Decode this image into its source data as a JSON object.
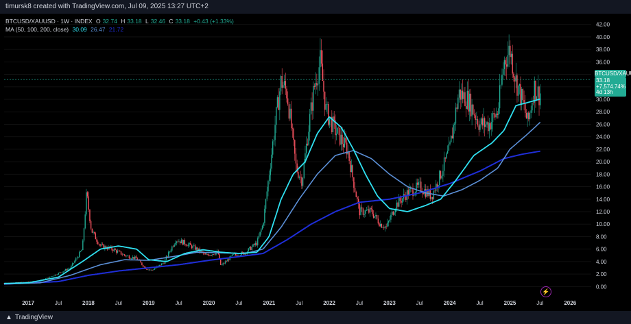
{
  "caption": "timursk8 created with TradingView.com, Jul 09, 2025 13:27 UTC+2",
  "symbol": {
    "name": "BTCUSD/XAUUSD · 1W · INDEX",
    "open_label": "O",
    "open": "32.74",
    "high_label": "H",
    "high": "33.18",
    "low_label": "L",
    "low": "32.46",
    "close_label": "C",
    "close": "33.18",
    "change": "+0.43 (+1.33%)"
  },
  "ma": {
    "label": "MA (50, 100, 200, close)",
    "v50": "30.09",
    "v100": "26.47",
    "v200": "21.72"
  },
  "price_tag": {
    "name": "BTCUSD/XAUUSD",
    "value": "33.18",
    "pct": "+7,574.74%",
    "time": "4d 13h"
  },
  "footer": {
    "brand": "TradingView"
  },
  "colors": {
    "up": "#22ab94",
    "down": "#f7525f",
    "ma50": "#2fe0f0",
    "ma100": "#5b8fd6",
    "ma200": "#1f2ed8",
    "price_line": "#22ab94",
    "grid": "#1a1a1a",
    "axis_text": "#d1d4dc"
  },
  "chart_data": {
    "type": "candlestick",
    "yticks": [
      0,
      2,
      4,
      6,
      8,
      10,
      12,
      14,
      16,
      18,
      20,
      22,
      24,
      26,
      28,
      30,
      32,
      34,
      36,
      38,
      40,
      42
    ],
    "ytick_labels": [
      "0.00",
      "2.00",
      "4.00",
      "6.00",
      "8.00",
      "10.00",
      "12.00",
      "14.00",
      "16.00",
      "18.00",
      "20.00",
      "22.00",
      "24.00",
      "26.00",
      "28.00",
      "30.00",
      "32.00",
      "34.00",
      "36.00",
      "38.00",
      "40.00",
      "42.00"
    ],
    "ylim": [
      -1.5,
      43.5
    ],
    "xlim": [
      2016.6,
      2026.35
    ],
    "xticks": [
      {
        "t": 2017.0,
        "label": "2017"
      },
      {
        "t": 2017.5,
        "label": "Jul"
      },
      {
        "t": 2018.0,
        "label": "2018"
      },
      {
        "t": 2018.5,
        "label": "Jul"
      },
      {
        "t": 2019.0,
        "label": "2019"
      },
      {
        "t": 2019.5,
        "label": "Jul"
      },
      {
        "t": 2020.0,
        "label": "2020"
      },
      {
        "t": 2020.5,
        "label": "Jul"
      },
      {
        "t": 2021.0,
        "label": "2021"
      },
      {
        "t": 2021.5,
        "label": "Jul"
      },
      {
        "t": 2022.0,
        "label": "2022"
      },
      {
        "t": 2022.5,
        "label": "Jul"
      },
      {
        "t": 2023.0,
        "label": "2023"
      },
      {
        "t": 2023.5,
        "label": "Jul"
      },
      {
        "t": 2024.0,
        "label": "2024"
      },
      {
        "t": 2024.5,
        "label": "Jul"
      },
      {
        "t": 2025.0,
        "label": "2025"
      },
      {
        "t": 2025.5,
        "label": "Jul"
      },
      {
        "t": 2026.0,
        "label": "2026"
      }
    ],
    "price_anchors": [
      [
        2016.6,
        0.55
      ],
      [
        2016.9,
        0.7
      ],
      [
        2017.2,
        0.9
      ],
      [
        2017.45,
        1.9
      ],
      [
        2017.7,
        3.0
      ],
      [
        2017.9,
        6.0
      ],
      [
        2017.97,
        15.0
      ],
      [
        2018.05,
        9.0
      ],
      [
        2018.2,
        6.5
      ],
      [
        2018.4,
        6.0
      ],
      [
        2018.6,
        5.0
      ],
      [
        2018.8,
        4.5
      ],
      [
        2018.95,
        2.9
      ],
      [
        2019.05,
        2.6
      ],
      [
        2019.25,
        3.8
      ],
      [
        2019.45,
        7.5
      ],
      [
        2019.6,
        7.0
      ],
      [
        2019.8,
        6.0
      ],
      [
        2019.95,
        5.0
      ],
      [
        2020.15,
        5.5
      ],
      [
        2020.2,
        3.3
      ],
      [
        2020.4,
        5.0
      ],
      [
        2020.6,
        5.4
      ],
      [
        2020.8,
        7.0
      ],
      [
        2020.9,
        10.0
      ],
      [
        2021.0,
        18.0
      ],
      [
        2021.1,
        26.0
      ],
      [
        2021.2,
        33.0
      ],
      [
        2021.3,
        31.0
      ],
      [
        2021.45,
        19.0
      ],
      [
        2021.55,
        17.0
      ],
      [
        2021.65,
        25.0
      ],
      [
        2021.75,
        32.0
      ],
      [
        2021.85,
        36.0
      ],
      [
        2021.95,
        28.0
      ],
      [
        2022.1,
        25.0
      ],
      [
        2022.3,
        22.0
      ],
      [
        2022.4,
        17.0
      ],
      [
        2022.5,
        12.0
      ],
      [
        2022.7,
        12.0
      ],
      [
        2022.85,
        10.0
      ],
      [
        2022.95,
        9.5
      ],
      [
        2023.1,
        13.0
      ],
      [
        2023.3,
        15.0
      ],
      [
        2023.5,
        16.0
      ],
      [
        2023.7,
        14.5
      ],
      [
        2023.85,
        18.0
      ],
      [
        2024.0,
        22.0
      ],
      [
        2024.15,
        31.0
      ],
      [
        2024.3,
        30.0
      ],
      [
        2024.5,
        26.0
      ],
      [
        2024.65,
        26.0
      ],
      [
        2024.8,
        28.0
      ],
      [
        2024.9,
        36.0
      ],
      [
        2025.0,
        38.0
      ],
      [
        2025.1,
        33.0
      ],
      [
        2025.2,
        30.0
      ],
      [
        2025.3,
        26.0
      ],
      [
        2025.4,
        32.0
      ],
      [
        2025.5,
        30.5
      ],
      [
        2025.52,
        33.18
      ]
    ],
    "ma50_anchors": [
      [
        2016.6,
        0.5
      ],
      [
        2017.0,
        0.6
      ],
      [
        2017.5,
        1.5
      ],
      [
        2017.9,
        4.0
      ],
      [
        2018.2,
        6.0
      ],
      [
        2018.5,
        6.5
      ],
      [
        2018.8,
        6.0
      ],
      [
        2019.0,
        4.3
      ],
      [
        2019.3,
        4.0
      ],
      [
        2019.6,
        5.3
      ],
      [
        2019.9,
        5.9
      ],
      [
        2020.2,
        5.5
      ],
      [
        2020.5,
        5.3
      ],
      [
        2020.8,
        5.5
      ],
      [
        2021.0,
        8.0
      ],
      [
        2021.2,
        14.0
      ],
      [
        2021.4,
        18.0
      ],
      [
        2021.6,
        20.0
      ],
      [
        2021.8,
        24.5
      ],
      [
        2022.0,
        27.2
      ],
      [
        2022.2,
        25.5
      ],
      [
        2022.4,
        22.0
      ],
      [
        2022.6,
        18.0
      ],
      [
        2022.8,
        14.5
      ],
      [
        2023.0,
        12.5
      ],
      [
        2023.3,
        12.0
      ],
      [
        2023.6,
        13.0
      ],
      [
        2023.85,
        14.0
      ],
      [
        2024.1,
        17.0
      ],
      [
        2024.4,
        21.0
      ],
      [
        2024.7,
        23.0
      ],
      [
        2024.9,
        25.0
      ],
      [
        2025.1,
        29.0
      ],
      [
        2025.3,
        29.5
      ],
      [
        2025.52,
        30.09
      ]
    ],
    "ma100_anchors": [
      [
        2016.6,
        0.4
      ],
      [
        2017.2,
        0.6
      ],
      [
        2017.7,
        1.8
      ],
      [
        2018.2,
        3.5
      ],
      [
        2018.6,
        4.3
      ],
      [
        2019.0,
        4.2
      ],
      [
        2019.4,
        4.8
      ],
      [
        2019.8,
        5.5
      ],
      [
        2020.2,
        5.4
      ],
      [
        2020.6,
        5.3
      ],
      [
        2020.9,
        6.0
      ],
      [
        2021.2,
        9.5
      ],
      [
        2021.5,
        14.0
      ],
      [
        2021.8,
        18.0
      ],
      [
        2022.1,
        21.0
      ],
      [
        2022.4,
        21.8
      ],
      [
        2022.7,
        20.5
      ],
      [
        2023.0,
        18.0
      ],
      [
        2023.3,
        16.0
      ],
      [
        2023.6,
        15.0
      ],
      [
        2023.9,
        14.5
      ],
      [
        2024.2,
        15.5
      ],
      [
        2024.5,
        17.0
      ],
      [
        2024.8,
        19.0
      ],
      [
        2025.0,
        22.0
      ],
      [
        2025.3,
        24.5
      ],
      [
        2025.52,
        26.47
      ]
    ],
    "ma200_anchors": [
      [
        2016.6,
        0.4
      ],
      [
        2017.5,
        0.8
      ],
      [
        2018.0,
        1.8
      ],
      [
        2018.5,
        2.5
      ],
      [
        2019.0,
        3.0
      ],
      [
        2019.5,
        3.5
      ],
      [
        2020.0,
        4.2
      ],
      [
        2020.5,
        4.8
      ],
      [
        2020.9,
        5.3
      ],
      [
        2021.3,
        7.5
      ],
      [
        2021.7,
        10.0
      ],
      [
        2022.1,
        12.0
      ],
      [
        2022.5,
        13.5
      ],
      [
        2023.0,
        14.0
      ],
      [
        2023.5,
        15.0
      ],
      [
        2024.0,
        16.5
      ],
      [
        2024.5,
        18.5
      ],
      [
        2024.9,
        20.5
      ],
      [
        2025.2,
        21.2
      ],
      [
        2025.52,
        21.72
      ]
    ]
  }
}
